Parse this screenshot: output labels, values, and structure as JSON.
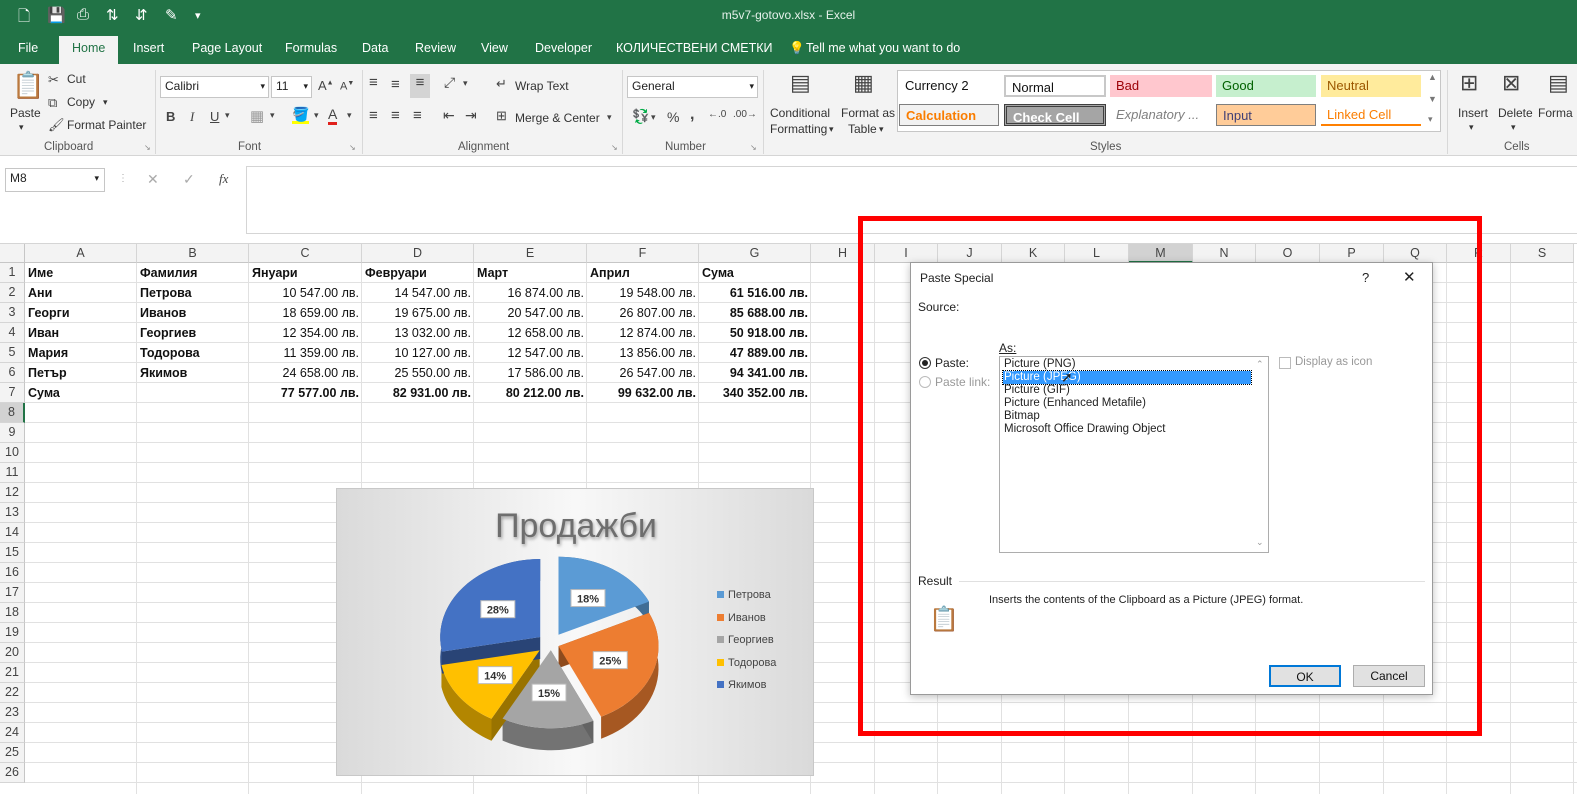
{
  "window": {
    "title": "m5v7-gotovo.xlsx  -  Excel"
  },
  "tabs": [
    "File",
    "Home",
    "Insert",
    "Page Layout",
    "Formulas",
    "Data",
    "Review",
    "View",
    "Developer",
    "КОЛИЧЕСТВЕНИ СМЕТКИ"
  ],
  "tell_me": "Tell me what you want to do",
  "ribbon": {
    "clipboard": {
      "label": "Clipboard",
      "paste": "Paste",
      "cut": "Cut",
      "copy": "Copy",
      "format_painter": "Format Painter"
    },
    "font": {
      "label": "Font",
      "name": "Calibri",
      "size": "11",
      "bold": "B",
      "italic": "I",
      "underline": "U"
    },
    "alignment": {
      "label": "Alignment",
      "wrap_text": "Wrap Text",
      "merge_center": "Merge & Center"
    },
    "number": {
      "label": "Number",
      "format": "General",
      "percent": "%",
      "comma": ","
    },
    "styles": {
      "label": "Styles",
      "conditional": "Conditional",
      "conditional2": "Formatting",
      "format_as": "Format as",
      "format_as2": "Table",
      "cells": [
        "Currency 2",
        "Normal",
        "Bad",
        "Good",
        "Neutral",
        "Calculation",
        "Check Cell",
        "Explanatory ...",
        "Input",
        "Linked Cell"
      ]
    },
    "cells": {
      "label": "Cells",
      "insert": "Insert",
      "delete": "Delete",
      "format": "Forma"
    }
  },
  "formula_bar": {
    "name_box": "M8",
    "fx": "fx",
    "cancel": "✕",
    "enter": "✓"
  },
  "sheet": {
    "columns": [
      "A",
      "B",
      "C",
      "D",
      "E",
      "F",
      "G",
      "H",
      "I",
      "J",
      "K",
      "L",
      "M",
      "N",
      "O",
      "P",
      "Q",
      "R",
      "S"
    ],
    "rows": [
      "1",
      "2",
      "3",
      "4",
      "5",
      "6",
      "7",
      "8",
      "9",
      "10",
      "11",
      "12",
      "13",
      "14",
      "15",
      "16",
      "17",
      "18",
      "19",
      "20",
      "21",
      "22",
      "23",
      "24",
      "25",
      "26"
    ],
    "header": [
      "Име",
      "Фамилия",
      "Януари",
      "Февруари",
      "Март",
      "Април",
      "Сума"
    ],
    "data": [
      [
        "Ани",
        "Петрова",
        "10 547.00 лв.",
        "14 547.00 лв.",
        "16 874.00 лв.",
        "19 548.00 лв.",
        "61 516.00 лв."
      ],
      [
        "Георги",
        "Иванов",
        "18 659.00 лв.",
        "19 675.00 лв.",
        "20 547.00 лв.",
        "26 807.00 лв.",
        "85 688.00 лв."
      ],
      [
        "Иван",
        "Георгиев",
        "12 354.00 лв.",
        "13 032.00 лв.",
        "12 658.00 лв.",
        "12 874.00 лв.",
        "50 918.00 лв."
      ],
      [
        "Мария",
        "Тодорова",
        "11 359.00 лв.",
        "10 127.00 лв.",
        "12 547.00 лв.",
        "13 856.00 лв.",
        "47 889.00 лв."
      ],
      [
        "Петър",
        "Якимов",
        "24 658.00 лв.",
        "25 550.00 лв.",
        "17 586.00 лв.",
        "26 547.00 лв.",
        "94 341.00 лв."
      ]
    ],
    "total": [
      "Сума",
      "",
      "77 577.00 лв.",
      "82 931.00 лв.",
      "80 212.00 лв.",
      "99 632.00 лв.",
      "340 352.00 лв."
    ]
  },
  "chart_data": {
    "type": "pie",
    "title": "Продажби",
    "categories": [
      "Петрова",
      "Иванов",
      "Георгиев",
      "Тодорова",
      "Якимов"
    ],
    "values": [
      18,
      25,
      15,
      14,
      28
    ],
    "labels": [
      "18%",
      "25%",
      "15%",
      "14%",
      "28%"
    ],
    "colors": [
      "#5b9bd5",
      "#ed7d31",
      "#a5a5a5",
      "#ffc000",
      "#4472c4"
    ],
    "legend": "right"
  },
  "dialog": {
    "title": "Paste Special",
    "help": "?",
    "close": "✕",
    "source": "Source:",
    "as": "As:",
    "paste": "Paste:",
    "paste_link": "Paste link:",
    "options": [
      "Picture (PNG)",
      "Picture (JPEG)",
      "Picture (GIF)",
      "Picture (Enhanced Metafile)",
      "Bitmap",
      "Microsoft Office Drawing Object"
    ],
    "selected_option": "Picture (JPEG)",
    "display_as_icon": "Display as icon",
    "result": "Result",
    "result_text": "Inserts the contents of the Clipboard as a Picture (JPEG) format.",
    "ok": "OK",
    "cancel": "Cancel"
  },
  "colors": {
    "excel_green": "#217346",
    "highlight": "#ff0000",
    "selection": "#3399ff"
  }
}
